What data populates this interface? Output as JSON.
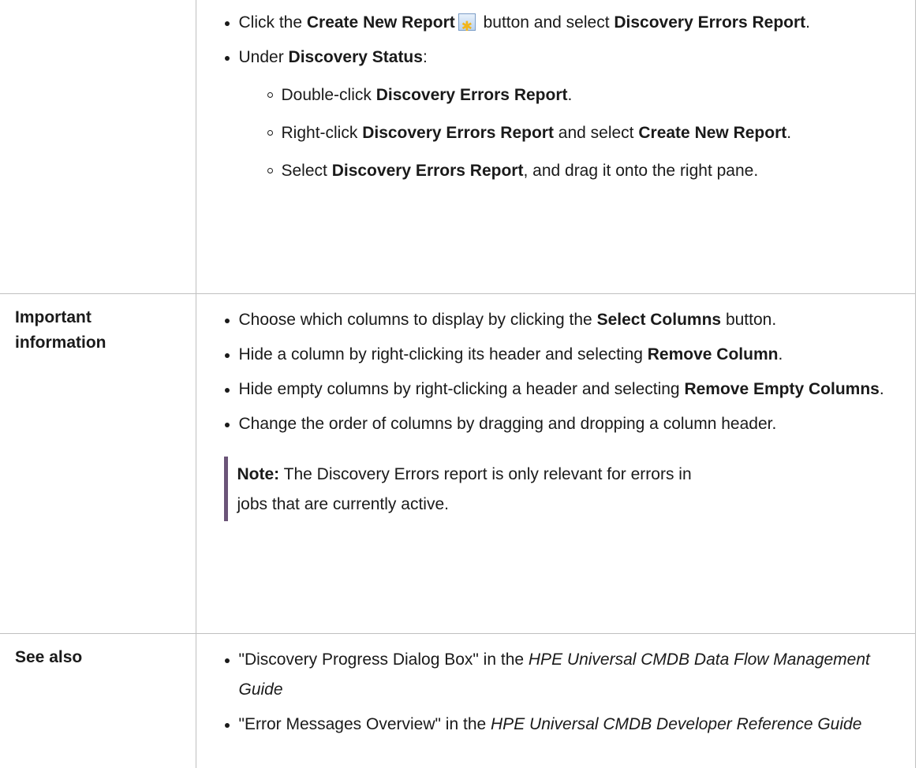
{
  "rows": [
    {
      "header": "",
      "bullets": [
        {
          "parts": [
            {
              "t": "Click the "
            },
            {
              "t": "Create New Report",
              "b": true
            },
            {
              "icon": "create-new-report-icon"
            },
            {
              "t": " button and select "
            },
            {
              "t": "Discovery Errors Report",
              "b": true
            },
            {
              "t": "."
            }
          ]
        },
        {
          "parts": [
            {
              "t": "Under "
            },
            {
              "t": "Discovery Status",
              "b": true
            },
            {
              "t": ":"
            }
          ],
          "sub": [
            {
              "parts": [
                {
                  "t": "Double-click "
                },
                {
                  "t": "Discovery Errors Report",
                  "b": true
                },
                {
                  "t": "."
                }
              ]
            },
            {
              "parts": [
                {
                  "t": "Right-click "
                },
                {
                  "t": "Discovery Errors Report",
                  "b": true
                },
                {
                  "t": " and select "
                },
                {
                  "t": "Create New Report",
                  "b": true
                },
                {
                  "t": "."
                }
              ]
            },
            {
              "parts": [
                {
                  "t": "Select "
                },
                {
                  "t": "Discovery Errors Report",
                  "b": true
                },
                {
                  "t": ", and drag it onto the right pane."
                }
              ]
            }
          ]
        }
      ]
    },
    {
      "header": "Important information",
      "bullets": [
        {
          "parts": [
            {
              "t": "Choose which columns to display by clicking the "
            },
            {
              "t": "Select Columns",
              "b": true
            },
            {
              "t": " button."
            }
          ]
        },
        {
          "parts": [
            {
              "t": "Hide a column by right-clicking its header and selecting "
            },
            {
              "t": "Remove Column",
              "b": true
            },
            {
              "t": "."
            }
          ]
        },
        {
          "parts": [
            {
              "t": "Hide empty columns by right-clicking a header and selecting "
            },
            {
              "t": "Remove Empty Columns",
              "b": true
            },
            {
              "t": "."
            }
          ]
        },
        {
          "parts": [
            {
              "t": "Change the order of columns by dragging and dropping a column header."
            }
          ]
        }
      ],
      "note": {
        "label": "Note:",
        "text": "  The Discovery Errors report is only relevant for errors in jobs that are currently active."
      }
    },
    {
      "header": "See also",
      "bullets": [
        {
          "parts": [
            {
              "t": "\"Discovery Progress Dialog Box\" in the "
            },
            {
              "t": "HPE Universal CMDB Data Flow Management Guide",
              "i": true
            }
          ]
        },
        {
          "parts": [
            {
              "t": "\"Error Messages Overview\" in the "
            },
            {
              "t": "HPE Universal CMDB Developer Reference Guide",
              "i": true
            }
          ]
        }
      ]
    }
  ]
}
